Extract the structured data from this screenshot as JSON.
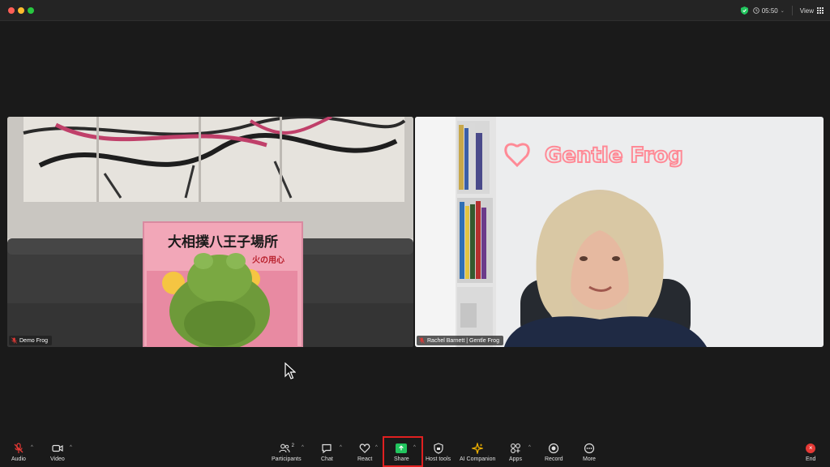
{
  "titlebar": {
    "timer": "05:50",
    "view_label": "View"
  },
  "participants": [
    {
      "name": "Demo Frog",
      "muted": true
    },
    {
      "name": "Rachel Barnett | Gentle Frog",
      "muted": true
    }
  ],
  "scene": {
    "book_title": "大相撲八王子場所",
    "book_subtitle": "火の用心",
    "sign_text": "Gentle Frog"
  },
  "toolbar": {
    "audio": "Audio",
    "video": "Video",
    "participants": "Participants",
    "participant_count": "2",
    "chat": "Chat",
    "react": "React",
    "share": "Share",
    "host_tools": "Host tools",
    "ai_companion": "AI Companion",
    "apps": "Apps",
    "record": "Record",
    "more": "More",
    "end": "End"
  },
  "colors": {
    "share_accent": "#22c55e",
    "end_red": "#e53935",
    "highlight_box": "#e02020",
    "ai_gold": "#f4b400"
  }
}
